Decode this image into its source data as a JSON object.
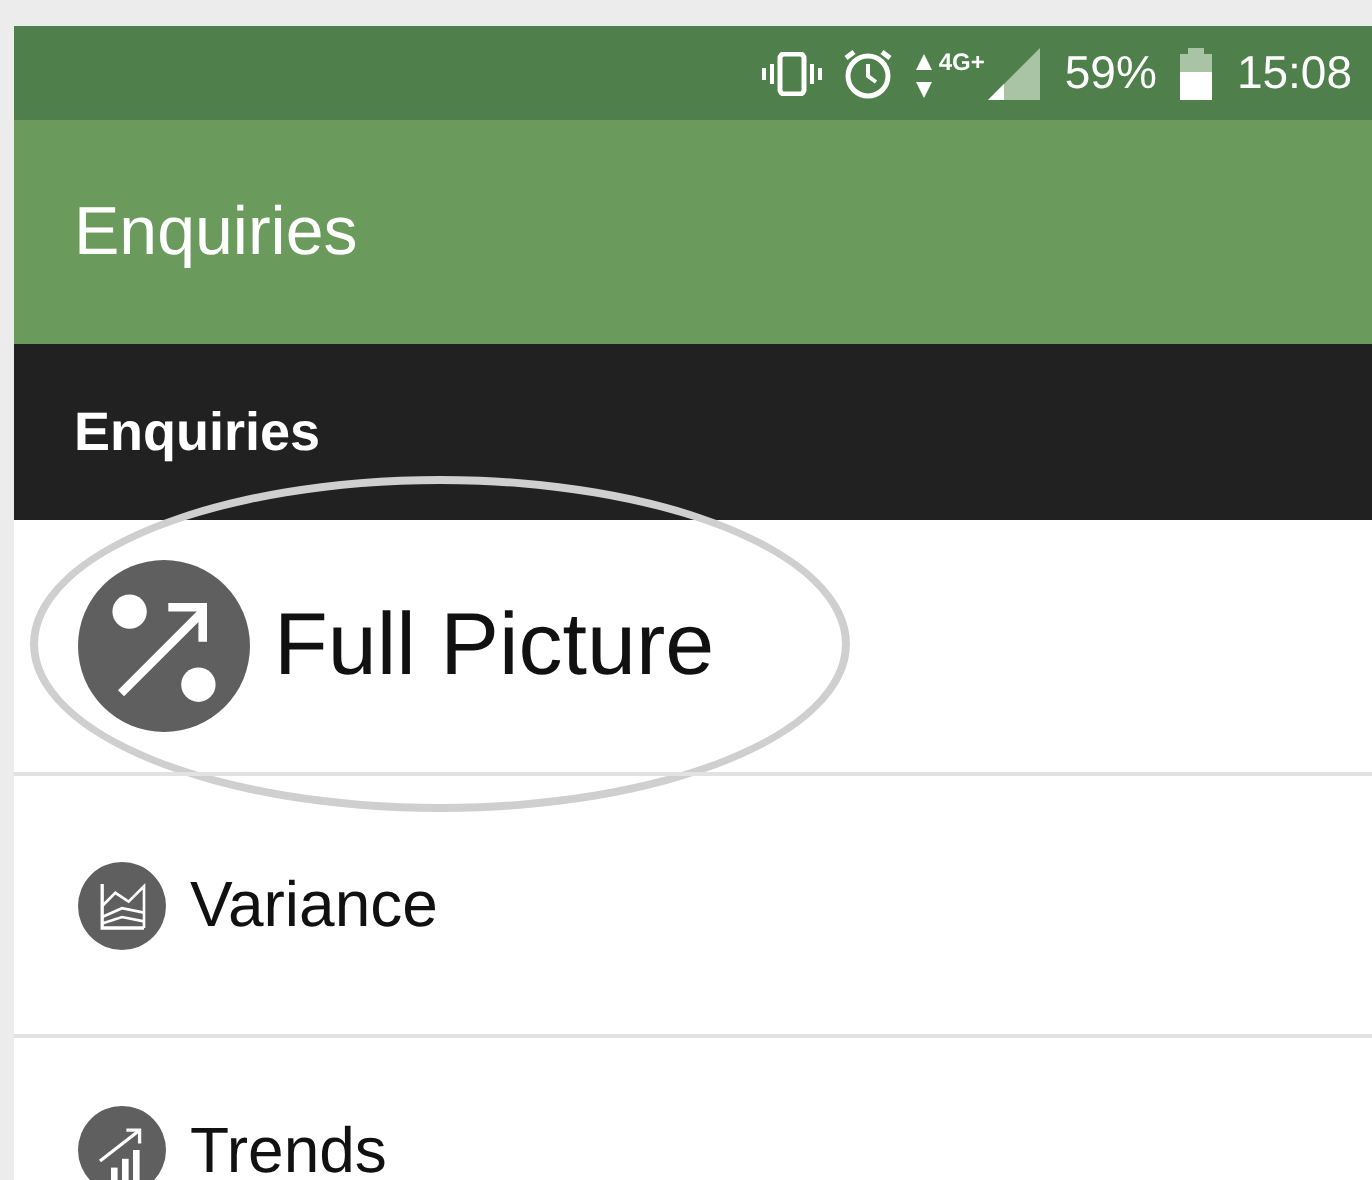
{
  "status_bar": {
    "network": "4G+",
    "battery": "59%",
    "time": "15:08"
  },
  "app_bar": {
    "title": "Enquiries"
  },
  "section": {
    "title": "Enquiries"
  },
  "items": [
    {
      "label": "Full Picture",
      "highlighted": true
    },
    {
      "label": "Variance",
      "highlighted": false
    },
    {
      "label": "Trends",
      "highlighted": false
    }
  ]
}
